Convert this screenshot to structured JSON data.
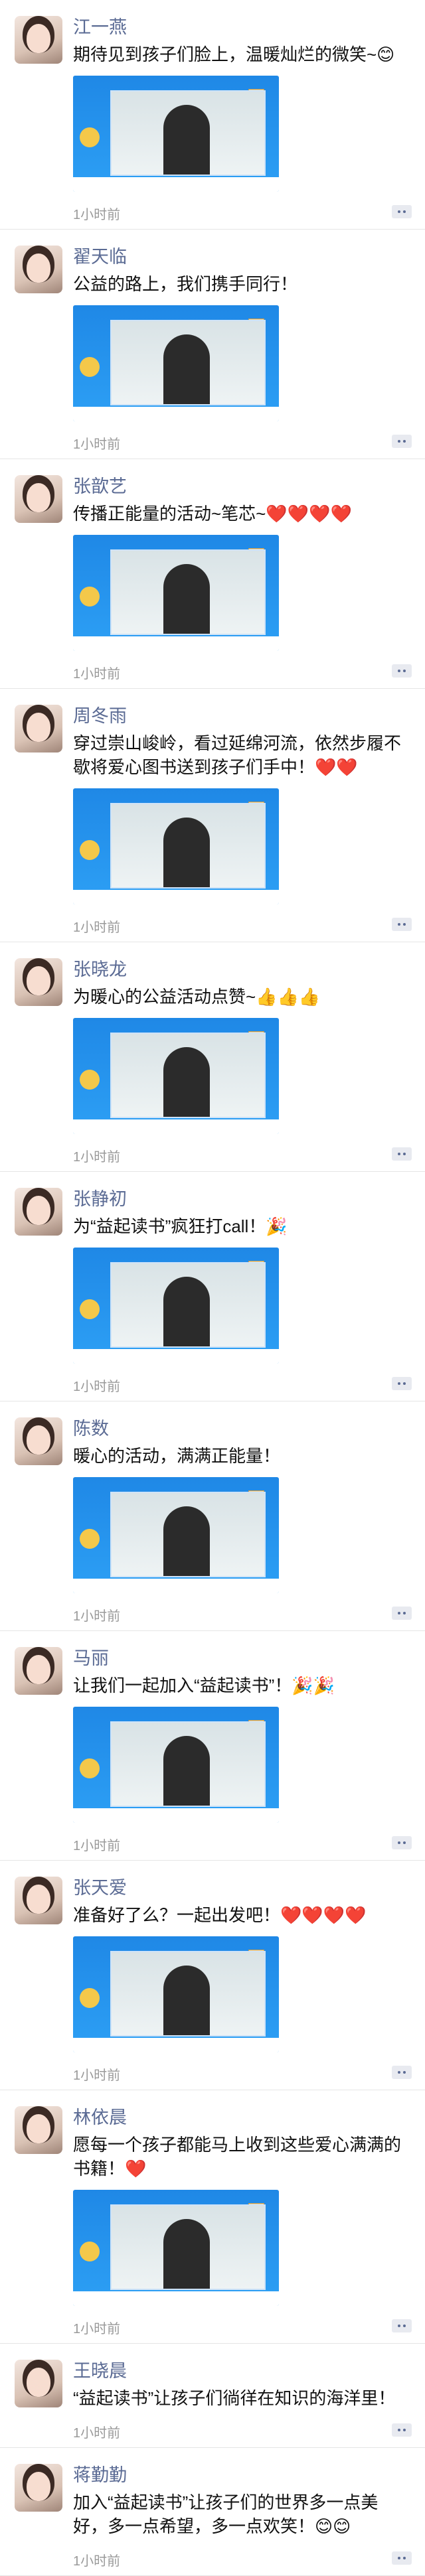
{
  "posts": [
    {
      "name": "江一燕",
      "text": "期待见到孩子们脸上，温暖灿烂的微笑~😊",
      "time": "1小时前"
    },
    {
      "name": "翟天临",
      "text": "公益的路上，我们携手同行！",
      "time": "1小时前"
    },
    {
      "name": "张歆艺",
      "text": "传播正能量的活动~笔芯~❤️❤️❤️❤️",
      "time": "1小时前"
    },
    {
      "name": "周冬雨",
      "text": "穿过崇山峻岭，看过延绵河流，依然步履不歇将爱心图书送到孩子们手中！❤️❤️",
      "time": "1小时前"
    },
    {
      "name": "张晓龙",
      "text": "为暖心的公益活动点赞~👍👍👍",
      "time": "1小时前"
    },
    {
      "name": "张静初",
      "text": "为“益起读书”疯狂打call！🎉",
      "time": "1小时前"
    },
    {
      "name": "陈数",
      "text": "暖心的活动，满满正能量！",
      "time": "1小时前"
    },
    {
      "name": "马丽",
      "text": "让我们一起加入“益起读书”！🎉🎉",
      "time": "1小时前"
    },
    {
      "name": "张天爱",
      "text": "准备好了么？一起出发吧！❤️❤️❤️❤️",
      "time": "1小时前"
    },
    {
      "name": "林依晨",
      "text": "愿每一个孩子都能马上收到这些爱心满满的书籍！❤️",
      "time": "1小时前"
    },
    {
      "name": "王晓晨",
      "text": "“益起读书”让孩子们徜徉在知识的海洋里！",
      "time": "1小时前"
    },
    {
      "name": "蒋勤勤",
      "text": "加入“益起读书”让孩子们的世界多一点美好，多一点希望，多一点欢笑！😊😊",
      "time": "1小时前"
    }
  ]
}
